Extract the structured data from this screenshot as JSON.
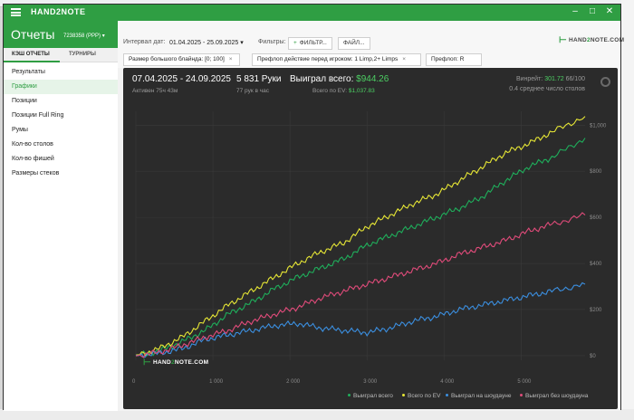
{
  "window": {
    "title": "HAND2NOTE",
    "min": "–",
    "max": "□",
    "close": "✕"
  },
  "sidebar": {
    "title": "Отчеты",
    "account": "7238358 (PPP) ▾",
    "tabs": [
      {
        "label": "КЭШ ОТЧЕТЫ"
      },
      {
        "label": "ТУРНИРЫ"
      }
    ],
    "items": [
      {
        "label": "Результаты"
      },
      {
        "label": "Графики"
      },
      {
        "label": "Позиции"
      },
      {
        "label": "Позиции Full Ring"
      },
      {
        "label": "Румы"
      },
      {
        "label": "Кол-во столов"
      },
      {
        "label": "Кол-во фишей"
      },
      {
        "label": "Размеры стеков"
      }
    ]
  },
  "toolbar": {
    "interval_label": "Интервал дат:",
    "interval_value": "01.04.2025 - 25.09.2025 ▾",
    "filters_label": "Фильтры:",
    "filter_button": "ФИЛЬТР...",
    "file_button": "ФАЙЛ...",
    "logo": {
      "pre": "HAND",
      "two": "2",
      "post": "NOTE.COM"
    },
    "chips": [
      {
        "label": "Размер большого блайнда: [0; 100]",
        "close": "×"
      },
      {
        "label": "Префлоп действие перед игроком: 1 Limp,2+ Limps",
        "close": "×"
      },
      {
        "label": "Префлоп: R",
        "close": ""
      }
    ]
  },
  "stats": {
    "range": "07.04.2025 - 24.09.2025",
    "active": "Активен 75ч 43м",
    "hands": "5 831 Руки",
    "hands_per_hour": "77 рук в час",
    "won_label": "Выиграл всего:",
    "won_value": "$944.26",
    "ev_label": "Всего по EV:",
    "ev_value": "$1,037.83",
    "winrate_label": "Винрейт:",
    "winrate_value": "301.72",
    "winrate_extra": "66/100",
    "avg_tables": "0.4 среднее число столов"
  },
  "chart_data": {
    "type": "line",
    "x_ticks": [
      0,
      1000,
      2000,
      3000,
      4000,
      5000
    ],
    "x_tick_labels": [
      "0",
      "1 000",
      "2 000",
      "3 000",
      "4 000",
      "5 000"
    ],
    "y_ticks": [
      0,
      200,
      400,
      600,
      800,
      1000
    ],
    "y_tick_labels": [
      "$0",
      "$200",
      "$400",
      "$600",
      "$800",
      "$1,000"
    ],
    "xlim": [
      0,
      5831
    ],
    "ylim": [
      -20,
      1060
    ],
    "grid": true,
    "legend_position": "bottom-right",
    "series": [
      {
        "name": "Выиграл всего",
        "color": "#1fae5b",
        "x": [
          0,
          300,
          600,
          900,
          1200,
          1500,
          1800,
          2100,
          2400,
          2700,
          3000,
          3300,
          3600,
          3900,
          4200,
          4500,
          4800,
          5100,
          5400,
          5831
        ],
        "y": [
          0,
          20,
          60,
          110,
          180,
          230,
          290,
          340,
          380,
          420,
          480,
          520,
          560,
          600,
          640,
          690,
          760,
          820,
          860,
          944
        ]
      },
      {
        "name": "Всего по EV",
        "color": "#e6e635",
        "x": [
          0,
          300,
          600,
          900,
          1200,
          1500,
          1800,
          2100,
          2400,
          2700,
          3000,
          3300,
          3600,
          3900,
          4200,
          4500,
          4800,
          5100,
          5400,
          5831
        ],
        "y": [
          0,
          30,
          80,
          150,
          220,
          280,
          340,
          400,
          450,
          490,
          560,
          610,
          660,
          700,
          760,
          820,
          880,
          920,
          970,
          1038
        ]
      },
      {
        "name": "Выиграл на шоудауне",
        "color": "#3b8fe0",
        "x": [
          0,
          300,
          600,
          900,
          1200,
          1500,
          1800,
          2100,
          2400,
          2700,
          3000,
          3300,
          3600,
          3900,
          4200,
          4500,
          4800,
          5100,
          5400,
          5831
        ],
        "y": [
          0,
          10,
          30,
          70,
          90,
          110,
          130,
          140,
          120,
          110,
          100,
          120,
          150,
          170,
          200,
          220,
          240,
          260,
          280,
          310
        ]
      },
      {
        "name": "Выиграл без шоудауна",
        "color": "#e04b7a",
        "x": [
          0,
          300,
          600,
          900,
          1200,
          1500,
          1800,
          2100,
          2400,
          2700,
          3000,
          3300,
          3600,
          3900,
          4200,
          4500,
          4800,
          5100,
          5400,
          5831
        ],
        "y": [
          0,
          15,
          45,
          80,
          110,
          150,
          180,
          210,
          250,
          280,
          310,
          340,
          370,
          400,
          440,
          470,
          500,
          540,
          570,
          610
        ]
      }
    ]
  },
  "watermark": {
    "pre": "HAND",
    "two": "2",
    "post": "NOTE.COM"
  },
  "colors": {
    "accent": "#2f9e43",
    "panel": "#2b2b2b"
  }
}
